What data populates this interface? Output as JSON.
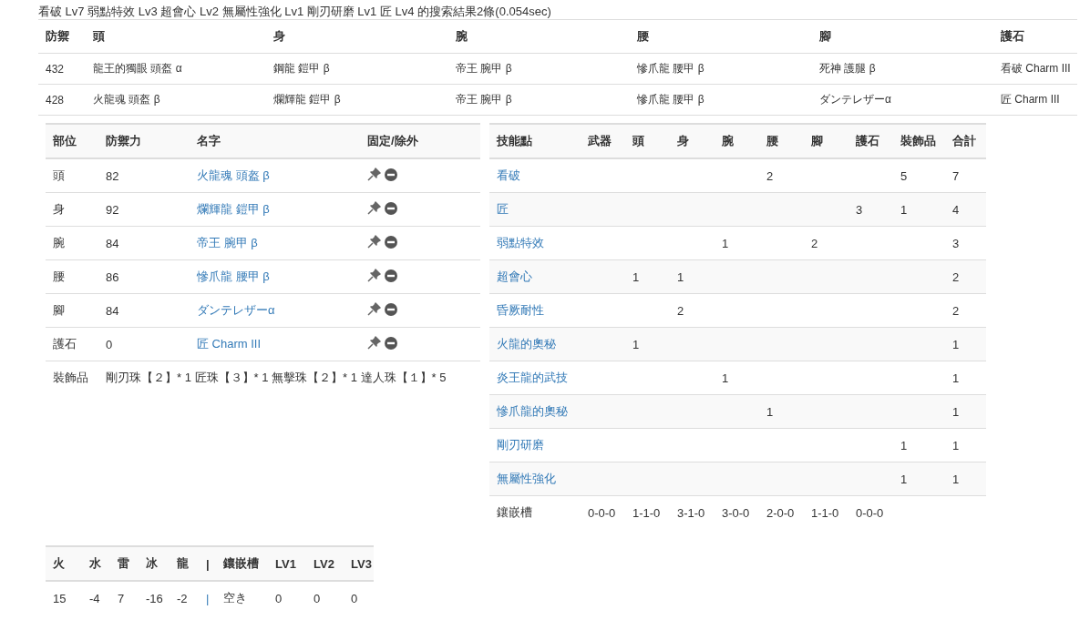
{
  "summary": "看破 Lv7 弱點特效 Lv3 超會心 Lv2 無屬性強化 Lv1 剛刃研磨 Lv1 匠 Lv4 的搜索結果2條(0.054sec)",
  "results": {
    "columns": [
      "防禦",
      "頭",
      "身",
      "腕",
      "腰",
      "腳",
      "護石"
    ],
    "rows": [
      {
        "cells": [
          "432",
          "龍王的獨眼 頭盔 α",
          "鋼龍 鎧甲 β",
          "帝王 腕甲 β",
          "慘爪龍 腰甲 β",
          "死神 護腿 β",
          "看破 Charm III"
        ]
      },
      {
        "cells": [
          "428",
          "火龍魂 頭盔 β",
          "爛輝龍 鎧甲 β",
          "帝王 腕甲 β",
          "慘爪龍 腰甲 β",
          "ダンテレザーα",
          "匠 Charm III"
        ]
      }
    ]
  },
  "parts": {
    "columns": [
      "部位",
      "防禦力",
      "名字",
      "固定/除外"
    ],
    "rows": [
      {
        "part": "頭",
        "defense": "82",
        "name": "火龍魂 頭盔 β"
      },
      {
        "part": "身",
        "defense": "92",
        "name": "爛輝龍 鎧甲 β"
      },
      {
        "part": "腕",
        "defense": "84",
        "name": "帝王 腕甲 β"
      },
      {
        "part": "腰",
        "defense": "86",
        "name": "慘爪龍 腰甲 β"
      },
      {
        "part": "腳",
        "defense": "84",
        "name": "ダンテレザーα"
      },
      {
        "part": "護石",
        "defense": "0",
        "name": "匠 Charm III"
      }
    ],
    "decorations": {
      "label": "裝飾品",
      "text": "剛刃珠【２】* 1 匠珠【３】* 1 無擊珠【２】* 1 達人珠【１】* 5"
    }
  },
  "skills": {
    "columns": [
      "技能點",
      "武器",
      "頭",
      "身",
      "腕",
      "腰",
      "腳",
      "護石",
      "裝飾品",
      "合計"
    ],
    "rows": [
      {
        "name": "看破",
        "waist": "2",
        "decorations": "5",
        "total": "7"
      },
      {
        "name": "匠",
        "charm": "3",
        "decorations": "1",
        "total": "4"
      },
      {
        "name": "弱點特效",
        "arms": "1",
        "legs": "2",
        "total": "3"
      },
      {
        "name": "超會心",
        "head": "1",
        "body": "1",
        "total": "2"
      },
      {
        "name": "昏厥耐性",
        "body": "2",
        "total": "2"
      },
      {
        "name": "火龍的奧秘",
        "head": "1",
        "total": "1"
      },
      {
        "name": "炎王龍的武技",
        "arms": "1",
        "total": "1"
      },
      {
        "name": "慘爪龍的奧秘",
        "waist": "1",
        "total": "1"
      },
      {
        "name": "剛刃研磨",
        "decorations": "1",
        "total": "1"
      },
      {
        "name": "無屬性強化",
        "decorations": "1",
        "total": "1"
      }
    ],
    "slots": {
      "label": "鑲嵌槽",
      "values": [
        "0-0-0",
        "1-1-0",
        "3-1-0",
        "3-0-0",
        "2-0-0",
        "1-1-0",
        "0-0-0"
      ]
    }
  },
  "resistances": {
    "columns": [
      "火",
      "水",
      "雷",
      "冰",
      "龍",
      "|",
      "鑲嵌槽",
      "LV1",
      "LV2",
      "LV3"
    ],
    "values": [
      "15",
      "-4",
      "7",
      "-16",
      "-2",
      "|",
      "空き",
      "0",
      "0",
      "0"
    ]
  }
}
